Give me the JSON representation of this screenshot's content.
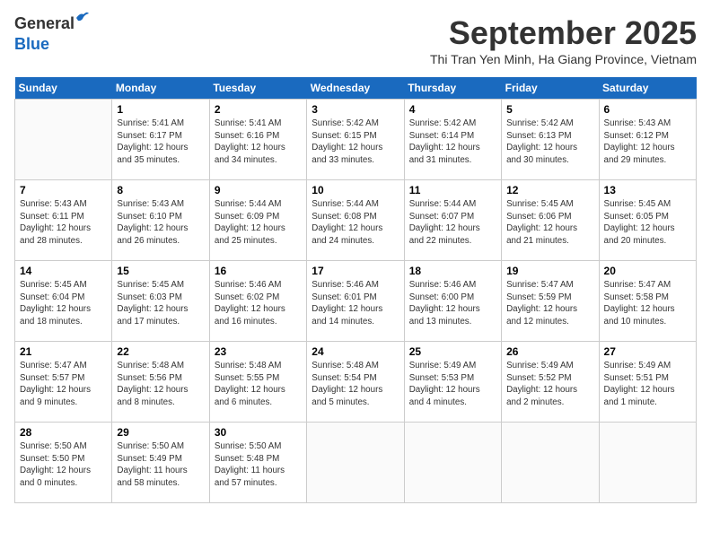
{
  "header": {
    "logo_line1": "General",
    "logo_line2": "Blue",
    "month_title": "September 2025",
    "subtitle": "Thi Tran Yen Minh, Ha Giang Province, Vietnam"
  },
  "days_of_week": [
    "Sunday",
    "Monday",
    "Tuesday",
    "Wednesday",
    "Thursday",
    "Friday",
    "Saturday"
  ],
  "weeks": [
    [
      {
        "day": "",
        "info": ""
      },
      {
        "day": "1",
        "info": "Sunrise: 5:41 AM\nSunset: 6:17 PM\nDaylight: 12 hours\nand 35 minutes."
      },
      {
        "day": "2",
        "info": "Sunrise: 5:41 AM\nSunset: 6:16 PM\nDaylight: 12 hours\nand 34 minutes."
      },
      {
        "day": "3",
        "info": "Sunrise: 5:42 AM\nSunset: 6:15 PM\nDaylight: 12 hours\nand 33 minutes."
      },
      {
        "day": "4",
        "info": "Sunrise: 5:42 AM\nSunset: 6:14 PM\nDaylight: 12 hours\nand 31 minutes."
      },
      {
        "day": "5",
        "info": "Sunrise: 5:42 AM\nSunset: 6:13 PM\nDaylight: 12 hours\nand 30 minutes."
      },
      {
        "day": "6",
        "info": "Sunrise: 5:43 AM\nSunset: 6:12 PM\nDaylight: 12 hours\nand 29 minutes."
      }
    ],
    [
      {
        "day": "7",
        "info": "Sunrise: 5:43 AM\nSunset: 6:11 PM\nDaylight: 12 hours\nand 28 minutes."
      },
      {
        "day": "8",
        "info": "Sunrise: 5:43 AM\nSunset: 6:10 PM\nDaylight: 12 hours\nand 26 minutes."
      },
      {
        "day": "9",
        "info": "Sunrise: 5:44 AM\nSunset: 6:09 PM\nDaylight: 12 hours\nand 25 minutes."
      },
      {
        "day": "10",
        "info": "Sunrise: 5:44 AM\nSunset: 6:08 PM\nDaylight: 12 hours\nand 24 minutes."
      },
      {
        "day": "11",
        "info": "Sunrise: 5:44 AM\nSunset: 6:07 PM\nDaylight: 12 hours\nand 22 minutes."
      },
      {
        "day": "12",
        "info": "Sunrise: 5:45 AM\nSunset: 6:06 PM\nDaylight: 12 hours\nand 21 minutes."
      },
      {
        "day": "13",
        "info": "Sunrise: 5:45 AM\nSunset: 6:05 PM\nDaylight: 12 hours\nand 20 minutes."
      }
    ],
    [
      {
        "day": "14",
        "info": "Sunrise: 5:45 AM\nSunset: 6:04 PM\nDaylight: 12 hours\nand 18 minutes."
      },
      {
        "day": "15",
        "info": "Sunrise: 5:45 AM\nSunset: 6:03 PM\nDaylight: 12 hours\nand 17 minutes."
      },
      {
        "day": "16",
        "info": "Sunrise: 5:46 AM\nSunset: 6:02 PM\nDaylight: 12 hours\nand 16 minutes."
      },
      {
        "day": "17",
        "info": "Sunrise: 5:46 AM\nSunset: 6:01 PM\nDaylight: 12 hours\nand 14 minutes."
      },
      {
        "day": "18",
        "info": "Sunrise: 5:46 AM\nSunset: 6:00 PM\nDaylight: 12 hours\nand 13 minutes."
      },
      {
        "day": "19",
        "info": "Sunrise: 5:47 AM\nSunset: 5:59 PM\nDaylight: 12 hours\nand 12 minutes."
      },
      {
        "day": "20",
        "info": "Sunrise: 5:47 AM\nSunset: 5:58 PM\nDaylight: 12 hours\nand 10 minutes."
      }
    ],
    [
      {
        "day": "21",
        "info": "Sunrise: 5:47 AM\nSunset: 5:57 PM\nDaylight: 12 hours\nand 9 minutes."
      },
      {
        "day": "22",
        "info": "Sunrise: 5:48 AM\nSunset: 5:56 PM\nDaylight: 12 hours\nand 8 minutes."
      },
      {
        "day": "23",
        "info": "Sunrise: 5:48 AM\nSunset: 5:55 PM\nDaylight: 12 hours\nand 6 minutes."
      },
      {
        "day": "24",
        "info": "Sunrise: 5:48 AM\nSunset: 5:54 PM\nDaylight: 12 hours\nand 5 minutes."
      },
      {
        "day": "25",
        "info": "Sunrise: 5:49 AM\nSunset: 5:53 PM\nDaylight: 12 hours\nand 4 minutes."
      },
      {
        "day": "26",
        "info": "Sunrise: 5:49 AM\nSunset: 5:52 PM\nDaylight: 12 hours\nand 2 minutes."
      },
      {
        "day": "27",
        "info": "Sunrise: 5:49 AM\nSunset: 5:51 PM\nDaylight: 12 hours\nand 1 minute."
      }
    ],
    [
      {
        "day": "28",
        "info": "Sunrise: 5:50 AM\nSunset: 5:50 PM\nDaylight: 12 hours\nand 0 minutes."
      },
      {
        "day": "29",
        "info": "Sunrise: 5:50 AM\nSunset: 5:49 PM\nDaylight: 11 hours\nand 58 minutes."
      },
      {
        "day": "30",
        "info": "Sunrise: 5:50 AM\nSunset: 5:48 PM\nDaylight: 11 hours\nand 57 minutes."
      },
      {
        "day": "",
        "info": ""
      },
      {
        "day": "",
        "info": ""
      },
      {
        "day": "",
        "info": ""
      },
      {
        "day": "",
        "info": ""
      }
    ]
  ]
}
